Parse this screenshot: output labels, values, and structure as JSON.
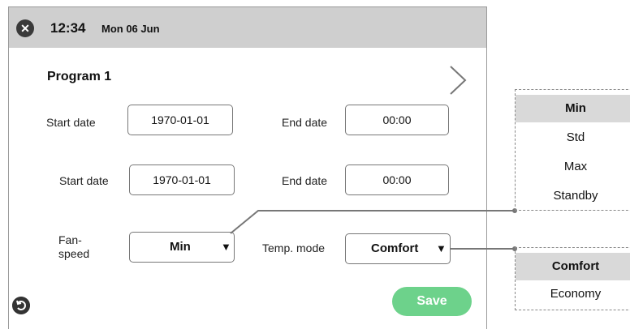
{
  "header": {
    "time": "12:34",
    "date": "Mon 06 Jun"
  },
  "program": {
    "title": "Program 1"
  },
  "row1": {
    "start_label": "Start date",
    "start_value": "1970-01-01",
    "end_label": "End date",
    "end_value": "00:00"
  },
  "row2": {
    "start_label": "Start date",
    "start_value": "1970-01-01",
    "end_label": "End date",
    "end_value": "00:00"
  },
  "fan": {
    "label": "Fan-\nspeed",
    "value": "Min",
    "options": [
      "Min",
      "Std",
      "Max",
      "Standby"
    ]
  },
  "temp": {
    "label": "Temp. mode",
    "value": "Comfort",
    "options": [
      "Comfort",
      "Economy"
    ]
  },
  "actions": {
    "save_label": "Save"
  },
  "icons": {
    "close": "close-icon",
    "next": "chevron-right-icon",
    "back": "back-icon"
  },
  "colors": {
    "topbar": "#cfcfcf",
    "save": "#6dd28b",
    "selected_option": "#d9d9d9"
  }
}
